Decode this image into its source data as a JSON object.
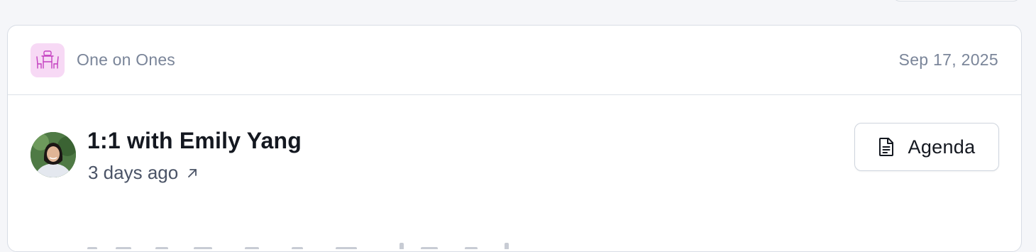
{
  "colors": {
    "page_bg": "#f5f6f9",
    "card_bg": "#ffffff",
    "border": "#d8dde5",
    "muted_text": "#7a8599",
    "title_text": "#141820",
    "category_icon_bg": "#f7d9f5",
    "category_icon_fg": "#c43fc0"
  },
  "card": {
    "category": {
      "icon": "meeting-table-icon",
      "label": "One on Ones"
    },
    "date": "Sep 17, 2025",
    "meeting": {
      "avatar": "avatar-emily-yang",
      "title": "1:1 with Emily Yang",
      "relative_time": "3 days ago",
      "time_icon": "arrow-up-right-icon"
    },
    "agenda_button": {
      "icon": "document-icon",
      "label": "Agenda"
    }
  }
}
